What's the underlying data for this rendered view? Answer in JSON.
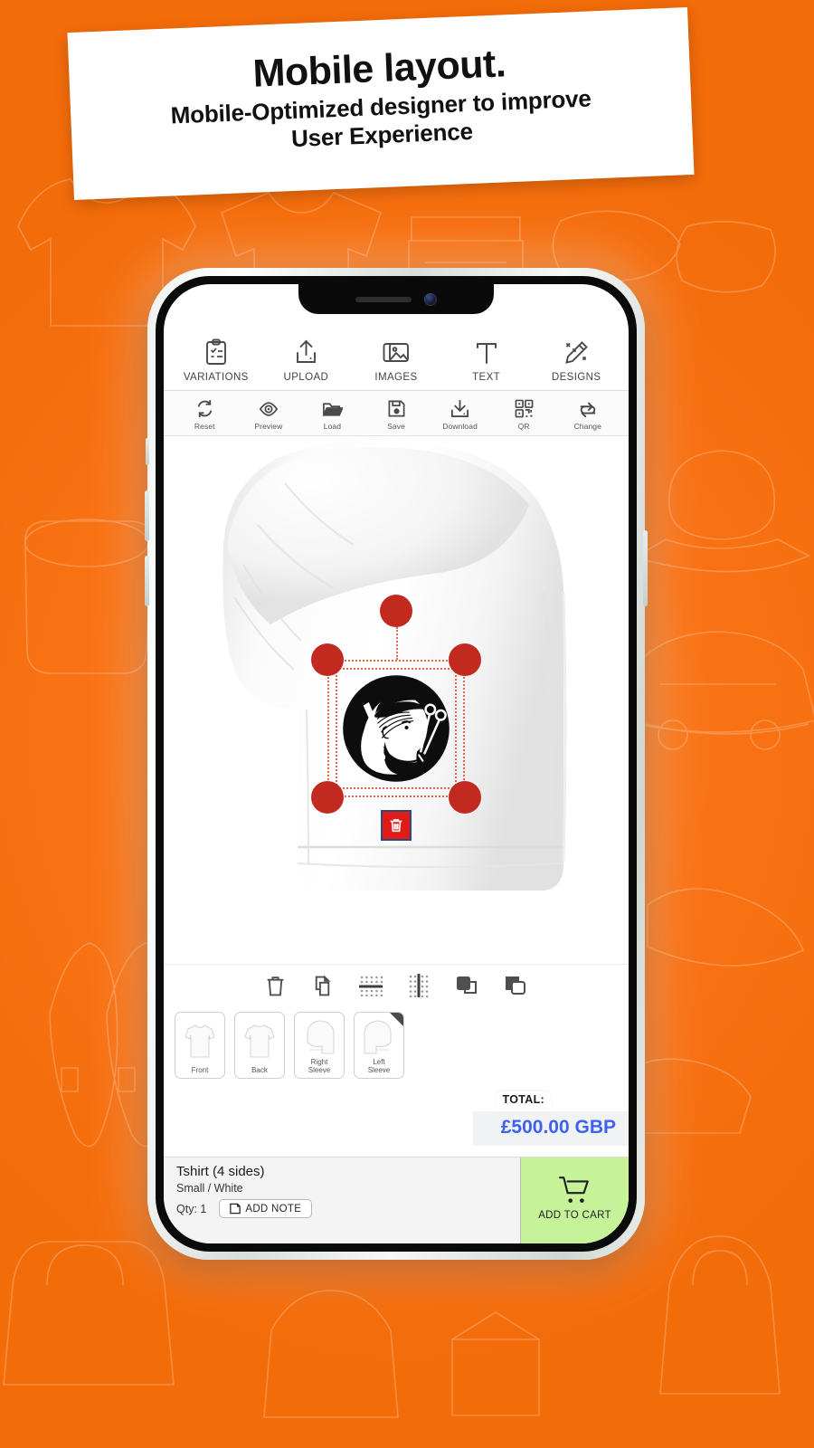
{
  "headline": {
    "title": "Mobile layout.",
    "subtitle_line1": "Mobile-Optimized designer to improve",
    "subtitle_line2": "User Experience"
  },
  "colors": {
    "background_orange": "#f97316",
    "handle_red": "#c32a1f",
    "selection_outline": "#e8644f",
    "delete_red": "#e11b18",
    "price_blue": "#3d62f0",
    "cart_green": "#c6f29a"
  },
  "toolbar_main": [
    {
      "label": "VARIATIONS",
      "icon": "clipboard-checklist-icon"
    },
    {
      "label": "UPLOAD",
      "icon": "upload-icon"
    },
    {
      "label": "IMAGES",
      "icon": "images-icon"
    },
    {
      "label": "TEXT",
      "icon": "text-icon"
    },
    {
      "label": "DESIGNS",
      "icon": "pencil-sparkle-icon"
    }
  ],
  "toolbar_sub": [
    {
      "label": "Reset",
      "icon": "refresh-icon"
    },
    {
      "label": "Preview",
      "icon": "eye-icon"
    },
    {
      "label": "Load",
      "icon": "folder-open-icon"
    },
    {
      "label": "Save",
      "icon": "floppy-disk-icon"
    },
    {
      "label": "Download",
      "icon": "download-icon"
    },
    {
      "label": "QR",
      "icon": "qr-code-icon"
    },
    {
      "label": "Change",
      "icon": "swap-arrows-icon"
    }
  ],
  "object_toolbar": [
    {
      "name": "delete",
      "icon": "trash-icon"
    },
    {
      "name": "duplicate",
      "icon": "copy-icon"
    },
    {
      "name": "center-horizontal",
      "icon": "align-center-horizontal-icon"
    },
    {
      "name": "center-vertical",
      "icon": "align-center-vertical-icon"
    },
    {
      "name": "bring-to-front",
      "icon": "bring-to-front-icon"
    },
    {
      "name": "send-to-back",
      "icon": "send-to-back-icon"
    }
  ],
  "canvas": {
    "product_view": "Left Sleeve",
    "design_name": "barber-beard-logo",
    "selected": true,
    "delete_badge": "trash-icon"
  },
  "sides": [
    {
      "label_line1": "Front",
      "label_line2": "",
      "selected": false
    },
    {
      "label_line1": "Back",
      "label_line2": "",
      "selected": false
    },
    {
      "label_line1": "Right",
      "label_line2": "Sleeve",
      "selected": false
    },
    {
      "label_line1": "Left",
      "label_line2": "Sleeve",
      "selected": true
    }
  ],
  "total": {
    "label": "TOTAL:",
    "value": "£500.00 GBP"
  },
  "cart": {
    "product_title": "Tshirt (4 sides)",
    "variant": "Small /  White",
    "qty": "Qty: 1",
    "add_note_label": "ADD NOTE",
    "add_note_icon": "note-icon",
    "add_to_cart_label": "ADD TO CART",
    "cart_icon": "shopping-cart-icon"
  }
}
